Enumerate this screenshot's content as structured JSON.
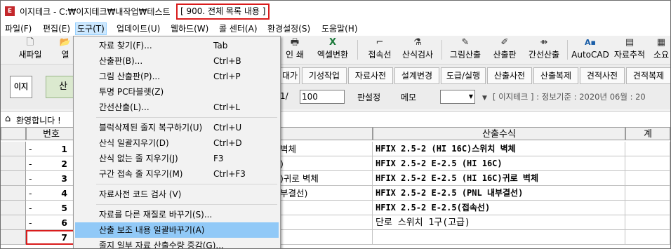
{
  "window": {
    "title": "이지테크 - C:₩이지테크₩내작업₩테스트",
    "title_highlight": "[ 900. 전체 목록 내용 ]",
    "app_icon_text": "E"
  },
  "menubar": [
    "파일(F)",
    "편집(E)",
    "도구(T)",
    "업데이트(U)",
    "웹하드(W)",
    "콜 센터(A)",
    "환경설정(S)",
    "도움말(H)"
  ],
  "toolbar": [
    {
      "label": "새파일",
      "icon": "new-file-icon"
    },
    {
      "label": "열",
      "icon": "open-folder-icon"
    },
    {
      "label": "인 쇄",
      "icon": "print-icon"
    },
    {
      "label": "엑셀변환",
      "icon": "excel-icon"
    },
    {
      "label": "접속선",
      "icon": "connector-icon"
    },
    {
      "label": "산식검사",
      "icon": "formula-check-icon"
    },
    {
      "label": "그림산출",
      "icon": "picture-calc-icon"
    },
    {
      "label": "산출판",
      "icon": "calc-board-icon"
    },
    {
      "label": "간선산출",
      "icon": "trunk-line-icon"
    },
    {
      "label": "AutoCAD",
      "icon": "autocad-icon"
    },
    {
      "label": "자료추적",
      "icon": "data-trace-icon"
    },
    {
      "label": "소요",
      "icon": "requirement-icon"
    }
  ],
  "band": {
    "logo_text": "이지",
    "green_button": "산"
  },
  "tabs": [
    "대가",
    "기성작업",
    "자료사전",
    "설계변경",
    "도급/실행",
    "산출사전",
    "산출복제",
    "견적사전",
    "견적복제"
  ],
  "page": {
    "label": "1/",
    "value": "100",
    "layout_button": "판설정",
    "memo_button": "메모"
  },
  "info_text": "[ 이지테크 ] : 정보기준 : 2020년 06월 : 20",
  "welcome": "환영합니다 !",
  "grid": {
    "headers": {
      "no": "번호",
      "formula": "산출수식",
      "total": "계"
    },
    "rows": [
      {
        "dash": "-",
        "no": "1",
        "left": "벽체",
        "formula": "HFIX 2.5-2 (HI 16C)스위치 벽체"
      },
      {
        "dash": "-",
        "no": "2",
        "left": ")",
        "formula": "HFIX 2.5-2 E-2.5 (HI 16C)"
      },
      {
        "dash": "-",
        "no": "3",
        "left": ")귀로 벽체",
        "formula": "HFIX 2.5-2 E-2.5 (HI 16C)귀로 벽체"
      },
      {
        "dash": "-",
        "no": "4",
        "left": "부결선)",
        "formula": "HFIX 2.5-2 E-2.5 (PNL 내부결선)"
      },
      {
        "dash": "-",
        "no": "5",
        "left": "",
        "formula": "HFIX 2.5-2 E-2.5(접속선)"
      },
      {
        "dash": "-",
        "no": "6",
        "left": "",
        "formula": "단로 스위치 1구(고급)"
      },
      {
        "dash": "",
        "no": "7",
        "left": "",
        "formula": ""
      }
    ]
  },
  "tools_menu": [
    {
      "label": "자료 찾기(F)...",
      "shortcut": "Tab"
    },
    {
      "label": "산출판(B)...",
      "shortcut": "Ctrl+B"
    },
    {
      "label": "그림 산출판(P)...",
      "shortcut": "Ctrl+P"
    },
    {
      "label": "투명 PC타블렛(Z)",
      "shortcut": ""
    },
    {
      "label": "간선산출(L)...",
      "shortcut": "Ctrl+L"
    },
    {
      "label": "블럭삭제된 줄지 복구하기(U)",
      "shortcut": "Ctrl+U"
    },
    {
      "label": "산식 일괄지우기(D)",
      "shortcut": "Ctrl+D"
    },
    {
      "label": "산식 없는 줄 지우기(J)",
      "shortcut": "F3"
    },
    {
      "label": "구간 접속 줄 지우기(M)",
      "shortcut": "Ctrl+F3"
    },
    {
      "label": "자료사전 코드 검사 (V)",
      "shortcut": ""
    },
    {
      "label": "자료를 다른 재질로 바꾸기(S)...",
      "shortcut": ""
    },
    {
      "label": "산출 보조 내용 일괄바꾸기(A)",
      "shortcut": ""
    },
    {
      "label": "줄지 일부 자료 산출수량 증감(G)...",
      "shortcut": ""
    }
  ],
  "colors": {
    "highlight_red": "#d91c1c",
    "menu_highlight": "#91c9f7",
    "active_menu": "#cce8ff"
  }
}
